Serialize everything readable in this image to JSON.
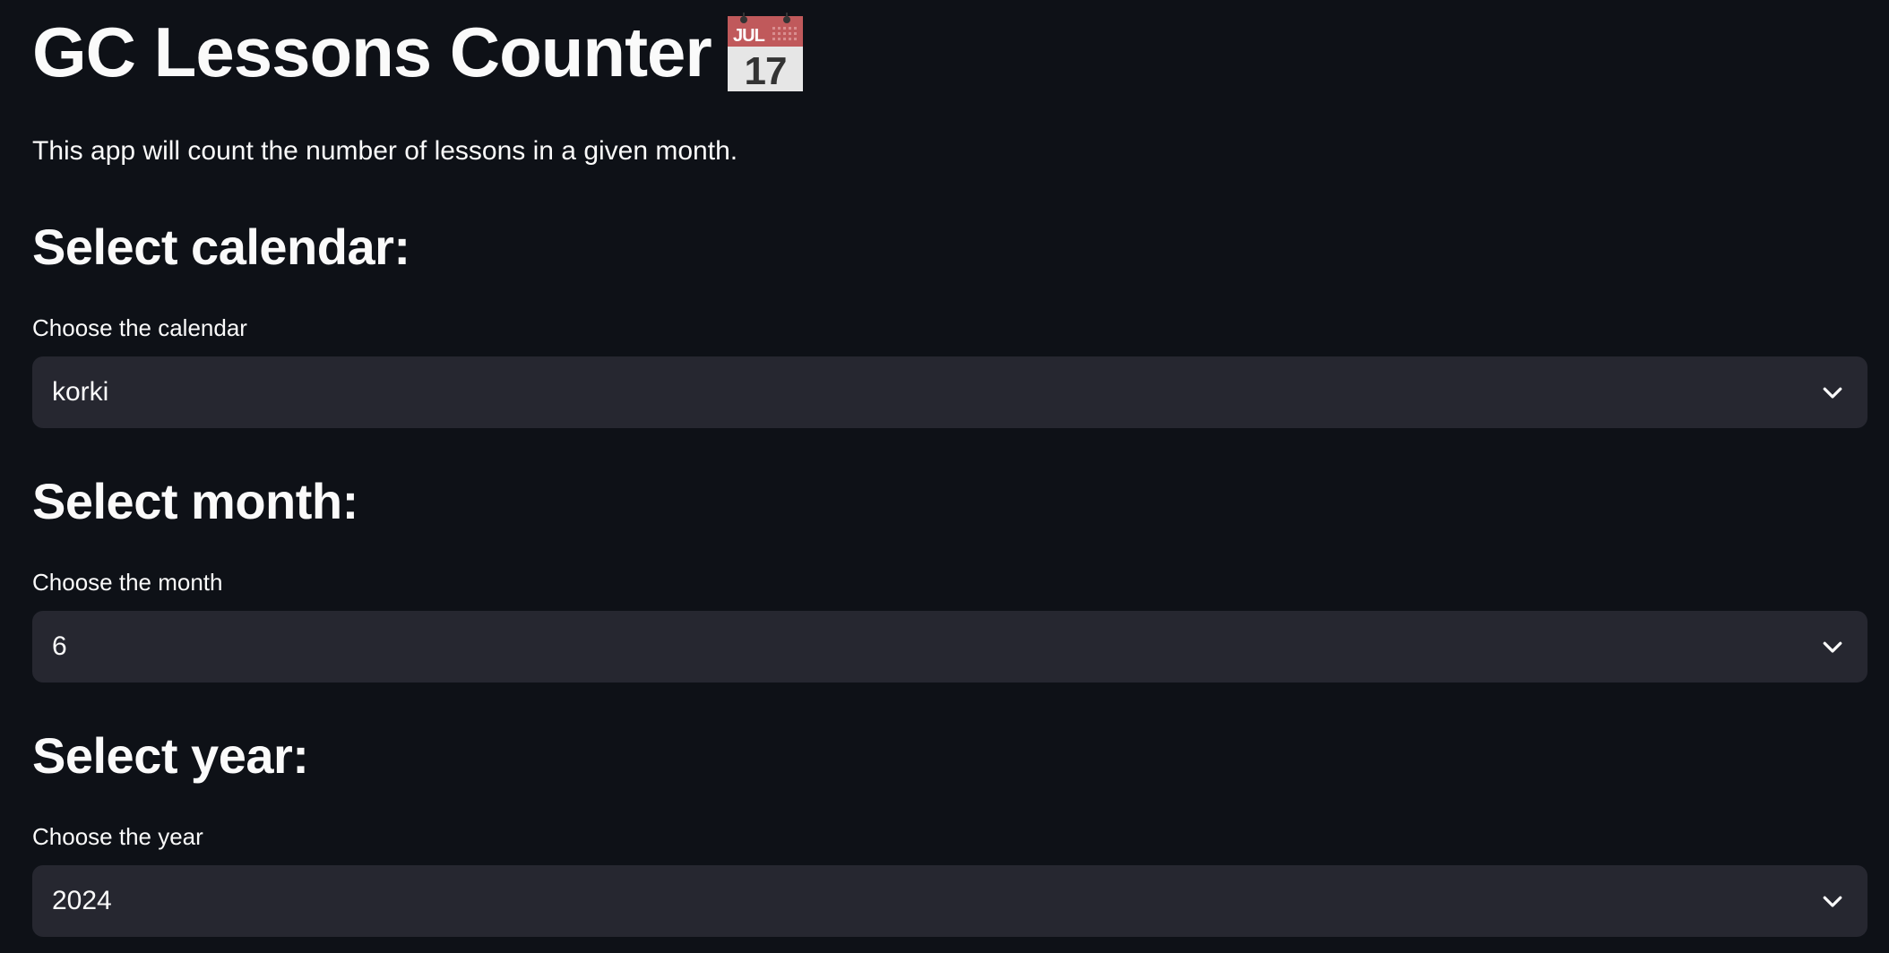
{
  "app": {
    "title": "GC Lessons Counter",
    "title_icon": "calendar-icon",
    "calendar_icon_month": "JUL",
    "calendar_icon_day": "17",
    "description": "This app will count the number of lessons in a given month."
  },
  "calendar_section": {
    "heading": "Select calendar:",
    "label": "Choose the calendar",
    "selected_value": "korki"
  },
  "month_section": {
    "heading": "Select month:",
    "label": "Choose the month",
    "selected_value": "6"
  },
  "year_section": {
    "heading": "Select year:",
    "label": "Choose the year",
    "selected_value": "2024"
  },
  "colors": {
    "background": "#0e1117",
    "select_background": "#262730",
    "text": "#fafafa",
    "calendar_header": "#c0595b"
  }
}
